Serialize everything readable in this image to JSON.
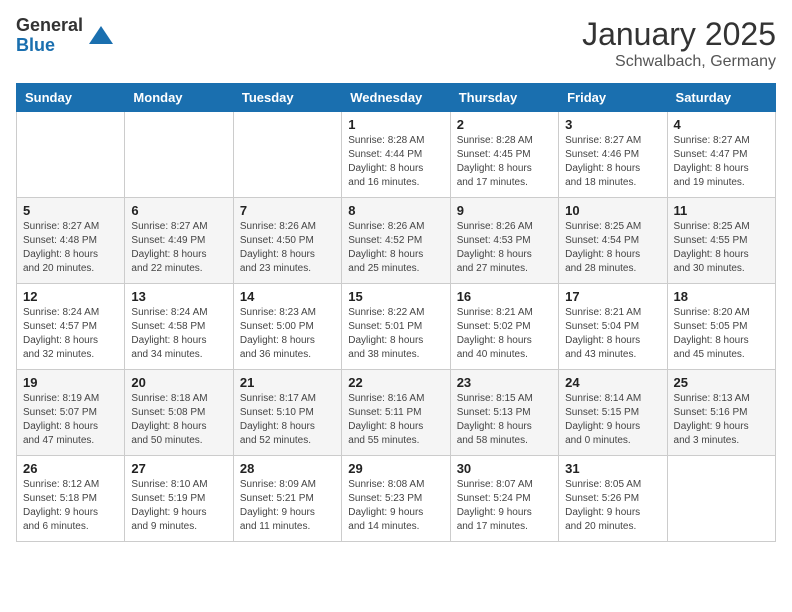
{
  "header": {
    "logo_general": "General",
    "logo_blue": "Blue",
    "month_title": "January 2025",
    "location": "Schwalbach, Germany"
  },
  "weekdays": [
    "Sunday",
    "Monday",
    "Tuesday",
    "Wednesday",
    "Thursday",
    "Friday",
    "Saturday"
  ],
  "weeks": [
    [
      {
        "day": "",
        "info": ""
      },
      {
        "day": "",
        "info": ""
      },
      {
        "day": "",
        "info": ""
      },
      {
        "day": "1",
        "info": "Sunrise: 8:28 AM\nSunset: 4:44 PM\nDaylight: 8 hours\nand 16 minutes."
      },
      {
        "day": "2",
        "info": "Sunrise: 8:28 AM\nSunset: 4:45 PM\nDaylight: 8 hours\nand 17 minutes."
      },
      {
        "day": "3",
        "info": "Sunrise: 8:27 AM\nSunset: 4:46 PM\nDaylight: 8 hours\nand 18 minutes."
      },
      {
        "day": "4",
        "info": "Sunrise: 8:27 AM\nSunset: 4:47 PM\nDaylight: 8 hours\nand 19 minutes."
      }
    ],
    [
      {
        "day": "5",
        "info": "Sunrise: 8:27 AM\nSunset: 4:48 PM\nDaylight: 8 hours\nand 20 minutes."
      },
      {
        "day": "6",
        "info": "Sunrise: 8:27 AM\nSunset: 4:49 PM\nDaylight: 8 hours\nand 22 minutes."
      },
      {
        "day": "7",
        "info": "Sunrise: 8:26 AM\nSunset: 4:50 PM\nDaylight: 8 hours\nand 23 minutes."
      },
      {
        "day": "8",
        "info": "Sunrise: 8:26 AM\nSunset: 4:52 PM\nDaylight: 8 hours\nand 25 minutes."
      },
      {
        "day": "9",
        "info": "Sunrise: 8:26 AM\nSunset: 4:53 PM\nDaylight: 8 hours\nand 27 minutes."
      },
      {
        "day": "10",
        "info": "Sunrise: 8:25 AM\nSunset: 4:54 PM\nDaylight: 8 hours\nand 28 minutes."
      },
      {
        "day": "11",
        "info": "Sunrise: 8:25 AM\nSunset: 4:55 PM\nDaylight: 8 hours\nand 30 minutes."
      }
    ],
    [
      {
        "day": "12",
        "info": "Sunrise: 8:24 AM\nSunset: 4:57 PM\nDaylight: 8 hours\nand 32 minutes."
      },
      {
        "day": "13",
        "info": "Sunrise: 8:24 AM\nSunset: 4:58 PM\nDaylight: 8 hours\nand 34 minutes."
      },
      {
        "day": "14",
        "info": "Sunrise: 8:23 AM\nSunset: 5:00 PM\nDaylight: 8 hours\nand 36 minutes."
      },
      {
        "day": "15",
        "info": "Sunrise: 8:22 AM\nSunset: 5:01 PM\nDaylight: 8 hours\nand 38 minutes."
      },
      {
        "day": "16",
        "info": "Sunrise: 8:21 AM\nSunset: 5:02 PM\nDaylight: 8 hours\nand 40 minutes."
      },
      {
        "day": "17",
        "info": "Sunrise: 8:21 AM\nSunset: 5:04 PM\nDaylight: 8 hours\nand 43 minutes."
      },
      {
        "day": "18",
        "info": "Sunrise: 8:20 AM\nSunset: 5:05 PM\nDaylight: 8 hours\nand 45 minutes."
      }
    ],
    [
      {
        "day": "19",
        "info": "Sunrise: 8:19 AM\nSunset: 5:07 PM\nDaylight: 8 hours\nand 47 minutes."
      },
      {
        "day": "20",
        "info": "Sunrise: 8:18 AM\nSunset: 5:08 PM\nDaylight: 8 hours\nand 50 minutes."
      },
      {
        "day": "21",
        "info": "Sunrise: 8:17 AM\nSunset: 5:10 PM\nDaylight: 8 hours\nand 52 minutes."
      },
      {
        "day": "22",
        "info": "Sunrise: 8:16 AM\nSunset: 5:11 PM\nDaylight: 8 hours\nand 55 minutes."
      },
      {
        "day": "23",
        "info": "Sunrise: 8:15 AM\nSunset: 5:13 PM\nDaylight: 8 hours\nand 58 minutes."
      },
      {
        "day": "24",
        "info": "Sunrise: 8:14 AM\nSunset: 5:15 PM\nDaylight: 9 hours\nand 0 minutes."
      },
      {
        "day": "25",
        "info": "Sunrise: 8:13 AM\nSunset: 5:16 PM\nDaylight: 9 hours\nand 3 minutes."
      }
    ],
    [
      {
        "day": "26",
        "info": "Sunrise: 8:12 AM\nSunset: 5:18 PM\nDaylight: 9 hours\nand 6 minutes."
      },
      {
        "day": "27",
        "info": "Sunrise: 8:10 AM\nSunset: 5:19 PM\nDaylight: 9 hours\nand 9 minutes."
      },
      {
        "day": "28",
        "info": "Sunrise: 8:09 AM\nSunset: 5:21 PM\nDaylight: 9 hours\nand 11 minutes."
      },
      {
        "day": "29",
        "info": "Sunrise: 8:08 AM\nSunset: 5:23 PM\nDaylight: 9 hours\nand 14 minutes."
      },
      {
        "day": "30",
        "info": "Sunrise: 8:07 AM\nSunset: 5:24 PM\nDaylight: 9 hours\nand 17 minutes."
      },
      {
        "day": "31",
        "info": "Sunrise: 8:05 AM\nSunset: 5:26 PM\nDaylight: 9 hours\nand 20 minutes."
      },
      {
        "day": "",
        "info": ""
      }
    ]
  ]
}
